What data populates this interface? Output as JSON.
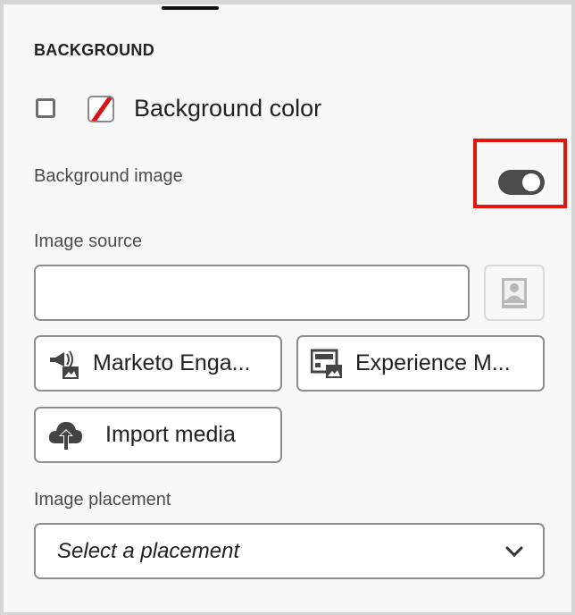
{
  "section_title": "BACKGROUND",
  "background_color": {
    "label": "Background color",
    "checked": false,
    "swatch": "none"
  },
  "background_image": {
    "label": "Background image",
    "enabled": true
  },
  "image_source": {
    "label": "Image source",
    "value": "",
    "placeholder": ""
  },
  "buttons": {
    "marketo": "Marketo Enga...",
    "experience": "Experience M...",
    "import": "Import media"
  },
  "image_placement": {
    "label": "Image placement",
    "value": "Select a placement"
  },
  "colors": {
    "highlight": "#e5140c",
    "toggle": "#4b4b4b"
  }
}
